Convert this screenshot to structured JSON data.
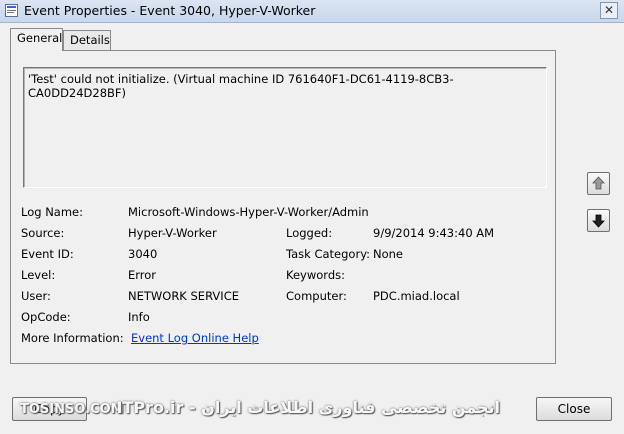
{
  "window": {
    "title": "Event Properties - Event 3040, Hyper-V-Worker",
    "close_glyph": "✕"
  },
  "tabs": [
    {
      "label": "General",
      "active": true
    },
    {
      "label": "Details",
      "active": false
    }
  ],
  "message": "'Test' could not initialize. (Virtual machine ID 761640F1-DC61-4119-8CB3-CA0DD24D28BF)",
  "fields": {
    "log_name": {
      "label": "Log Name:",
      "value": "Microsoft-Windows-Hyper-V-Worker/Admin"
    },
    "source": {
      "label": "Source:",
      "value": "Hyper-V-Worker"
    },
    "logged": {
      "label": "Logged:",
      "value": "9/9/2014 9:43:40 AM"
    },
    "event_id": {
      "label": "Event ID:",
      "value": "3040"
    },
    "task_category": {
      "label": "Task Category:",
      "value": "None"
    },
    "level": {
      "label": "Level:",
      "value": "Error"
    },
    "keywords": {
      "label": "Keywords:",
      "value": ""
    },
    "user": {
      "label": "User:",
      "value": "NETWORK SERVICE"
    },
    "computer": {
      "label": "Computer:",
      "value": "PDC.miad.local"
    },
    "opcode": {
      "label": "OpCode:",
      "value": "Info"
    },
    "more_info": {
      "label": "More Information:",
      "link": "Event Log Online Help"
    }
  },
  "buttons": {
    "copy": "Copy",
    "close": "Close",
    "up_icon": "arrow-up-icon",
    "down_icon": "arrow-down-icon"
  },
  "watermark": {
    "left": "TOSINSO.COM",
    "right": "ITPro.ir - انجمن تخصصی فناوری اطلاعات ایران"
  },
  "colors": {
    "link": "#0033cc",
    "background": "#f0f0f0"
  }
}
